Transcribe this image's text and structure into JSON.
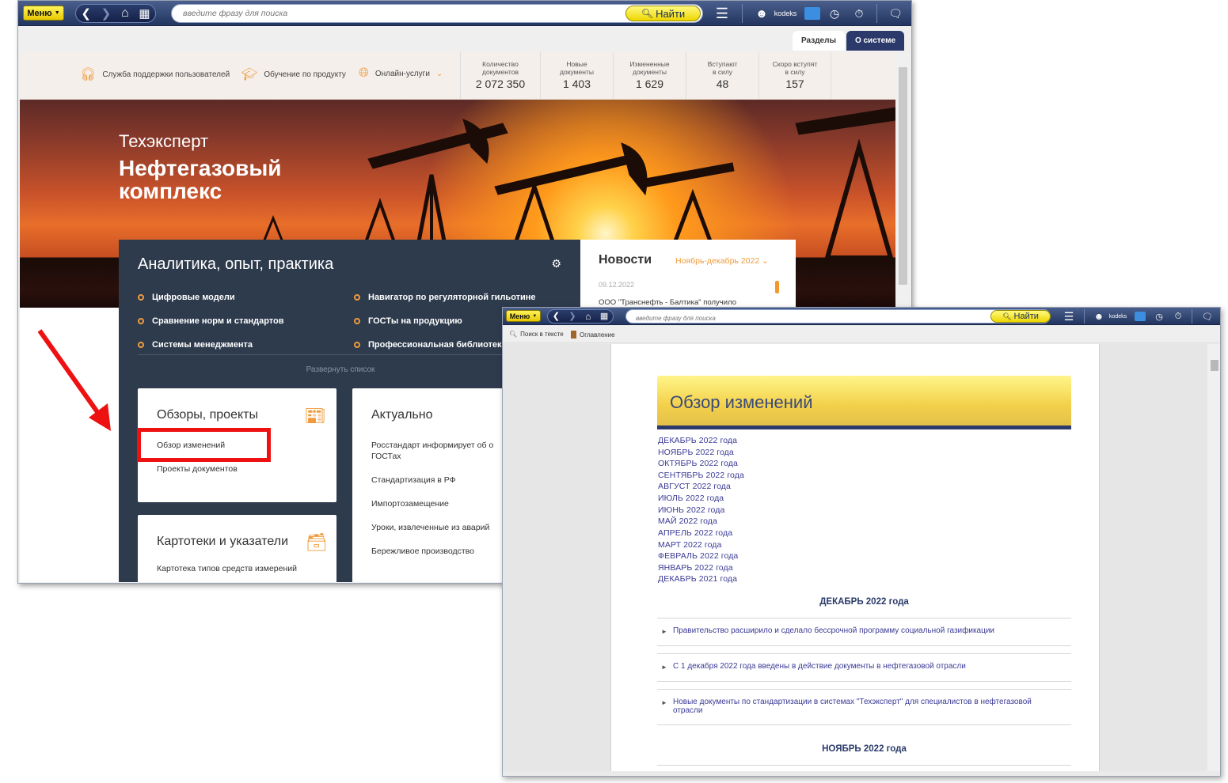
{
  "toolbar": {
    "menu_label": "Меню",
    "search_placeholder": "введите фразу для поиска",
    "find_label": "Найти",
    "username": "kodeks"
  },
  "tabs": [
    {
      "label": "Разделы"
    },
    {
      "label": "О системе"
    }
  ],
  "util": {
    "support": "Служба поддержки пользователей",
    "training": "Обучение по продукту",
    "online": "Онлайн-услуги"
  },
  "stats": [
    {
      "label1": "Количество",
      "label2": "документов",
      "value": "2 072 350"
    },
    {
      "label1": "Новые",
      "label2": "документы",
      "value": "1 403"
    },
    {
      "label1": "Измененные",
      "label2": "документы",
      "value": "1 629"
    },
    {
      "label1": "Вступают",
      "label2": "в силу",
      "value": "48"
    },
    {
      "label1": "Скоро вступят",
      "label2": "в силу",
      "value": "157"
    }
  ],
  "hero": {
    "subtitle": "Техэксперт",
    "title": "Нефтегазовый комплекс"
  },
  "analytics": {
    "title": "Аналитика, опыт, практика",
    "links_left": [
      "Цифровые модели",
      "Сравнение норм и стандартов",
      "Системы менеджмента"
    ],
    "links_right": [
      "Навигатор по регуляторной гильотине",
      "ГОСТы на продукцию",
      "Профессиональная библиотека"
    ],
    "expand": "Развернуть список"
  },
  "reviews_card": {
    "title": "Обзоры, проекты",
    "links": [
      "Обзор изменений",
      "Проекты документов"
    ]
  },
  "cards_card": {
    "title": "Картотеки и указатели",
    "links": [
      "Картотека типов средств измерений"
    ]
  },
  "actual_card": {
    "title": "Актуально",
    "links": [
      "Росстандарт информирует об о",
      "ГОСТах",
      "Стандартизация в РФ",
      "Импортозамещение",
      "Уроки, извлеченные из аварий",
      "Бережливое производство"
    ]
  },
  "news": {
    "title": "Новости",
    "period": "Ноябрь-декабрь 2022",
    "date": "09.12.2022",
    "text": "ООО \"Транснефть - Балтика\" получило"
  },
  "doc_toolbar": {
    "search_in_text": "Поиск в тексте",
    "toc": "Оглавление"
  },
  "doc": {
    "title": "Обзор изменений",
    "months": [
      "ДЕКАБРЬ 2022 года",
      "НОЯБРЬ 2022 года",
      "ОКТЯБРЬ 2022 года",
      "СЕНТЯБРЬ 2022 года",
      "АВГУСТ 2022 года",
      "ИЮЛЬ 2022 года",
      "ИЮНЬ 2022 года",
      "МАЙ 2022 года",
      "АПРЕЛЬ 2022 года",
      "МАРТ 2022 года",
      "ФЕВРАЛЬ 2022 года",
      "ЯНВАРЬ 2022 года",
      "ДЕКАБРЬ 2021 года"
    ],
    "section1": "ДЕКАБРЬ 2022 года",
    "items": [
      "Правительство расширило и сделало бессрочной программу социальной газификации",
      "С 1 декабря 2022 года введены в действие документы в нефтегазовой отрасли",
      "Новые документы по стандартизации в системах \"Техэксперт\" для специалистов в нефтегазовой отрасли"
    ],
    "section2": "НОЯБРЬ 2022 года"
  },
  "colors": {
    "accent": "#ef9b3d",
    "dark_panel": "#2e3b4d",
    "toolbar": "#223560",
    "highlight": "#ee1111"
  }
}
